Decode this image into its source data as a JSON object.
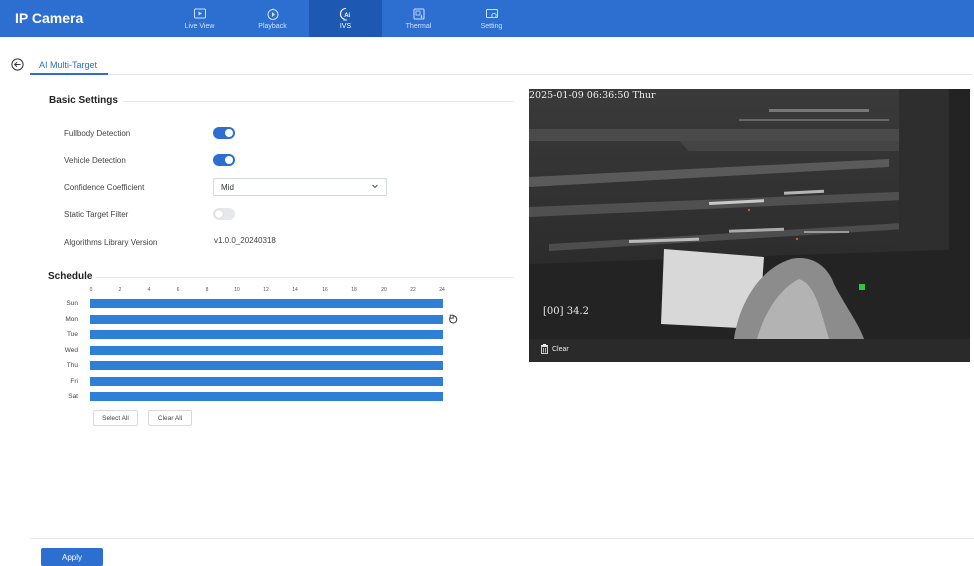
{
  "app": {
    "title": "IP Camera"
  },
  "nav": {
    "items": [
      {
        "label": "Live View",
        "icon": "live-view-icon",
        "active": false
      },
      {
        "label": "Playback",
        "icon": "playback-icon",
        "active": false
      },
      {
        "label": "IVS",
        "icon": "ivs-ai-icon",
        "active": true
      },
      {
        "label": "Thermal",
        "icon": "thermal-icon",
        "active": false
      },
      {
        "label": "Setting",
        "icon": "setting-icon",
        "active": false
      }
    ]
  },
  "tab": {
    "label": "AI Multi-Target"
  },
  "basic": {
    "title": "Basic Settings",
    "fullbody_label": "Fullbody Detection",
    "fullbody_enabled": true,
    "vehicle_label": "Vehicle Detection",
    "vehicle_enabled": true,
    "confidence_label": "Confidence Coefficient",
    "confidence_value": "Mid",
    "static_label": "Static Target Filter",
    "static_enabled": false,
    "version_label": "Algorithms Library Version",
    "version_value": "v1.0.0_20240318"
  },
  "schedule": {
    "title": "Schedule",
    "hours": [
      "0",
      "2",
      "4",
      "6",
      "8",
      "10",
      "12",
      "14",
      "16",
      "18",
      "20",
      "22",
      "24"
    ],
    "days": [
      "Sun",
      "Mon",
      "Tue",
      "Wed",
      "Thu",
      "Fri",
      "Sat"
    ],
    "select_all": "Select All",
    "clear_all": "Clear All"
  },
  "video": {
    "timestamp": "2025-01-09 06:36:50 Thur",
    "temp_readout": "[00] 34.2",
    "clear_label": "Clear"
  },
  "footer": {
    "apply": "Apply"
  },
  "colors": {
    "primary": "#2c6fd0",
    "nav_active": "#1d58b3",
    "schedule_bar": "#2f7fd6"
  }
}
